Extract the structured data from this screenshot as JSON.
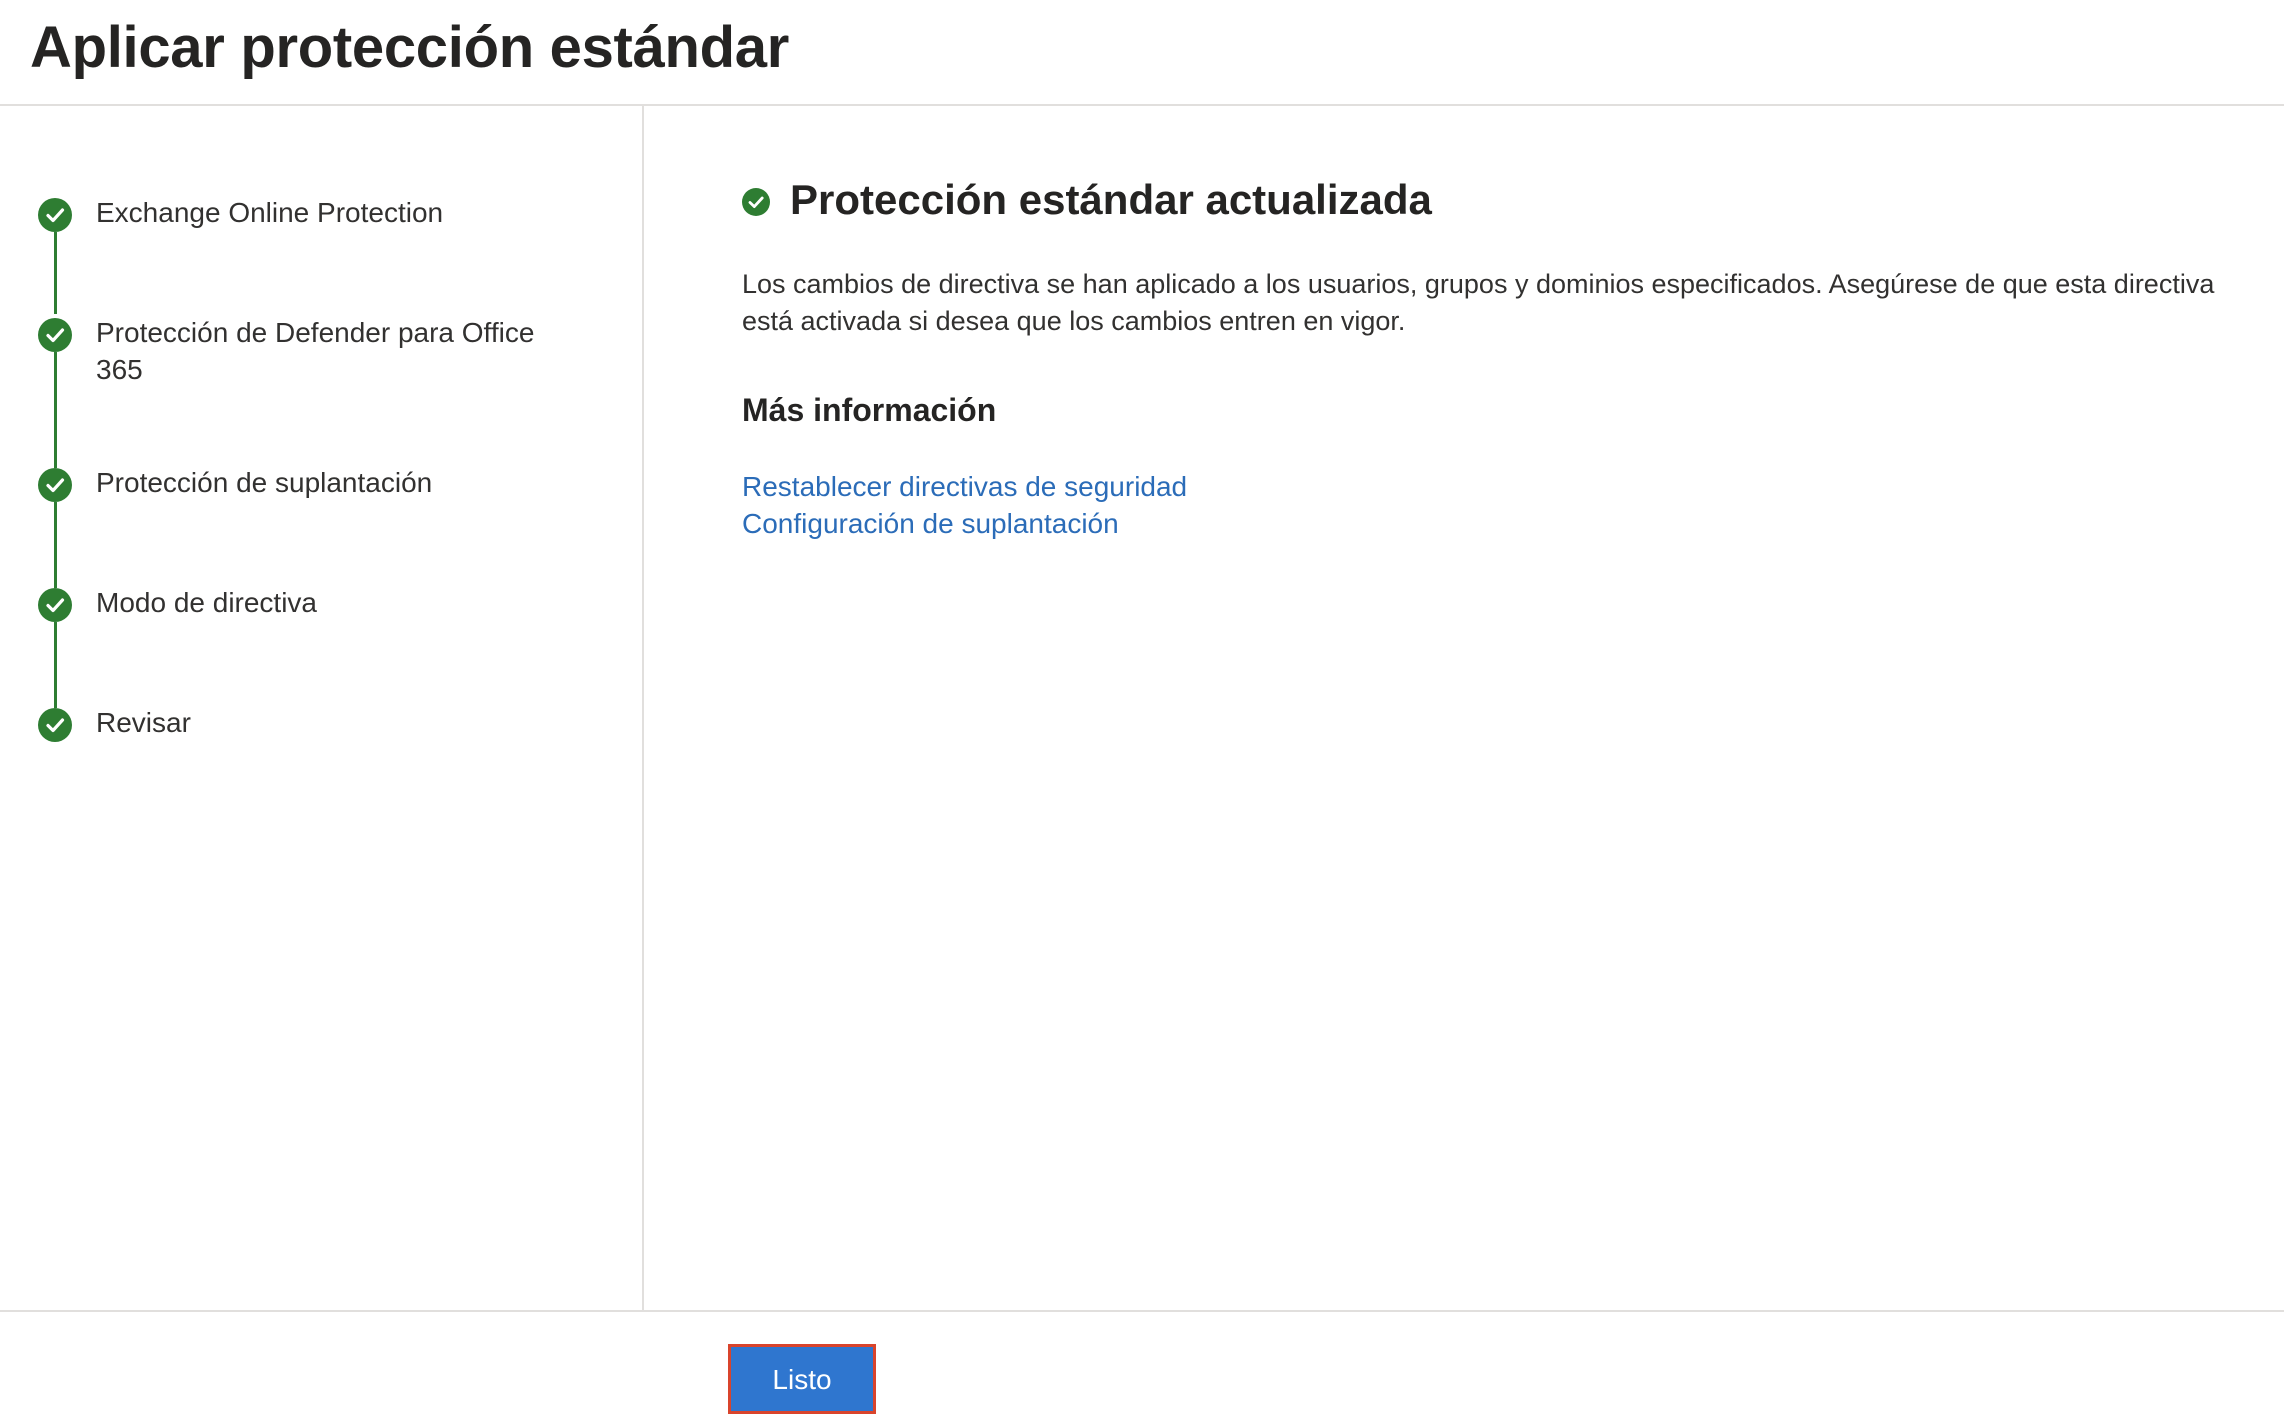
{
  "page": {
    "title": "Aplicar protección estándar"
  },
  "steps": [
    {
      "label": "Exchange Online Protection",
      "status": "completed"
    },
    {
      "label": "Protección de Defender para Office 365",
      "status": "completed"
    },
    {
      "label": "Protección de suplantación",
      "status": "completed"
    },
    {
      "label": "Modo de directiva",
      "status": "completed"
    },
    {
      "label": "Revisar",
      "status": "completed"
    }
  ],
  "main": {
    "status_icon": "check-circle-icon",
    "title": "Protección estándar actualizada",
    "description": "Los cambios de directiva se han aplicado a los usuarios, grupos y dominios especificados. Asegúrese de que esta directiva está activada si desea que los cambios entren en vigor.",
    "more_info_heading": "Más información",
    "links": [
      {
        "label": "Restablecer directivas de seguridad"
      },
      {
        "label": "Configuración de suplantación"
      }
    ]
  },
  "footer": {
    "done_label": "Listo"
  },
  "colors": {
    "success": "#2e7d32",
    "link": "#2b6cb8",
    "primary_button": "#2f76cf",
    "highlight_border": "#d9442c"
  }
}
